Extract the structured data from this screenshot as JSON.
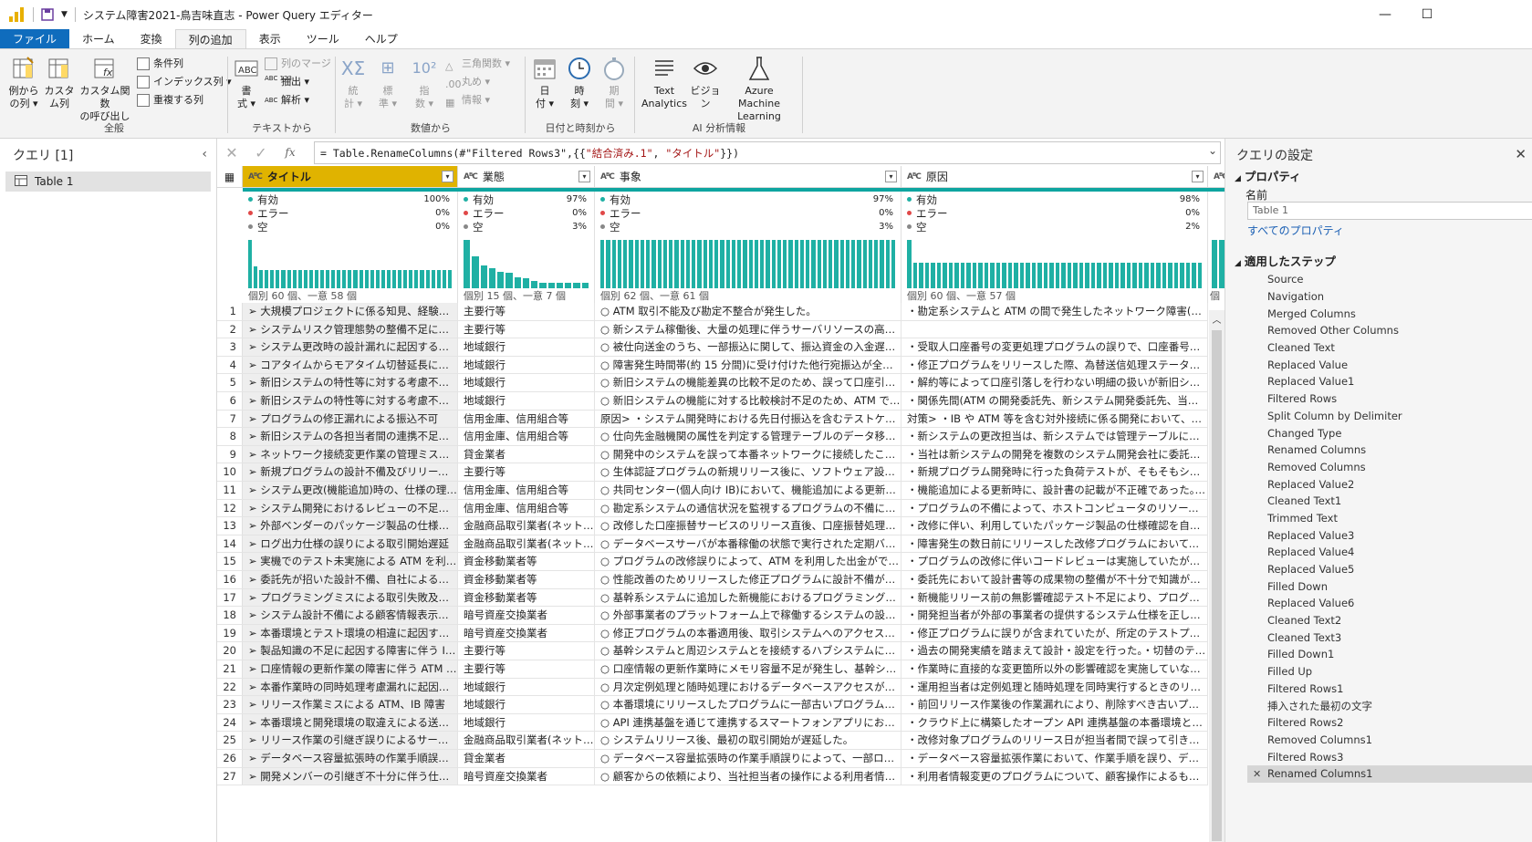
{
  "window": {
    "title": "システム障害2021-鳥吉味直志 - Power Query エディター",
    "controls": [
      "—",
      "☐",
      "✕"
    ]
  },
  "menu": [
    "ファイル",
    "ホーム",
    "変換",
    "列の追加",
    "表示",
    "ツール",
    "ヘルプ"
  ],
  "ribbon": {
    "general": {
      "label": "全般",
      "col_from_examples": [
        "例から",
        "の列 ▾"
      ],
      "custom_column": [
        "カスタ",
        "ム列"
      ],
      "invoke_custom_fn": [
        "カスタム関数",
        "の呼び出し"
      ],
      "conditional_column": "条件列",
      "index_column": "インデックス列 ▾",
      "duplicate_column": "重複する列"
    },
    "text": {
      "label": "テキストから",
      "format": [
        "書",
        "式 ▾"
      ],
      "merge_columns": "列のマージ",
      "extract": "抽出 ▾",
      "parse": "解析 ▾"
    },
    "number": {
      "label": "数値から",
      "statistics": [
        "統",
        "計 ▾"
      ],
      "standard": [
        "標",
        "準 ▾"
      ],
      "scientific": [
        "指",
        "数 ▾"
      ],
      "trig": "三角関数 ▾",
      "rounding": "丸め ▾",
      "information": "情報 ▾"
    },
    "datetime": {
      "label": "日付と時刻から",
      "date": [
        "日",
        "付 ▾"
      ],
      "time": [
        "時",
        "刻 ▾"
      ],
      "duration": [
        "期",
        "間 ▾"
      ]
    },
    "ai": {
      "label": "AI 分析情報",
      "text_analytics": [
        "Text",
        "Analytics"
      ],
      "vision": [
        "ビジョ",
        "ン"
      ],
      "azure_ml": [
        "Azure Machine",
        "Learning"
      ]
    }
  },
  "queries_pane": {
    "title": "クエリ [1]",
    "items": [
      "Table 1"
    ]
  },
  "formula_bar": {
    "prefix": "= Table.RenameColumns(#\"Filtered Rows3\",{{",
    "str1": "\"結合済み.1\"",
    "comma": ", ",
    "str2": "\"タイトル\"",
    "suffix": "}})"
  },
  "columns": [
    {
      "name": "タイトル",
      "valid": "100%",
      "error": "0%",
      "empty": "0%",
      "distinct": "個別 60 個、一意 58 個",
      "bars": [
        0.95,
        0.42,
        0.35,
        0.35,
        0.35,
        0.35,
        0.35,
        0.35,
        0.35,
        0.35,
        0.35,
        0.35,
        0.35,
        0.35,
        0.35,
        0.35,
        0.35,
        0.35,
        0.35,
        0.35,
        0.35,
        0.35,
        0.35,
        0.35,
        0.35,
        0.35,
        0.35,
        0.35,
        0.35,
        0.35,
        0.35,
        0.35,
        0.35,
        0.35,
        0.35,
        0.35,
        0.35
      ]
    },
    {
      "name": "業態",
      "valid": "97%",
      "error": "0%",
      "empty": "3%",
      "distinct": "個別 15 個、一意 7 個",
      "bars": [
        0.95,
        0.62,
        0.45,
        0.4,
        0.33,
        0.3,
        0.22,
        0.2,
        0.14,
        0.1,
        0.1,
        0.1,
        0.1,
        0.1,
        0.1
      ]
    },
    {
      "name": "事象",
      "valid": "97%",
      "error": "0%",
      "empty": "3%",
      "distinct": "個別 62 個、一意 61 個",
      "bars": [
        0.95,
        0.95,
        0.95,
        0.95,
        0.95,
        0.95,
        0.95,
        0.95,
        0.95,
        0.95,
        0.95,
        0.95,
        0.95,
        0.95,
        0.95,
        0.95,
        0.95,
        0.95,
        0.95,
        0.95,
        0.95,
        0.95,
        0.95,
        0.95,
        0.95,
        0.95,
        0.95,
        0.95,
        0.95,
        0.95,
        0.95,
        0.95,
        0.95,
        0.95,
        0.95,
        0.95,
        0.95,
        0.95,
        0.95,
        0.95,
        0.95,
        0.95,
        0.95,
        0.95,
        0.95,
        0.95,
        0.95,
        0.95,
        0.95,
        0.95,
        0.95,
        0.95
      ]
    },
    {
      "name": "原因",
      "valid": "98%",
      "error": "0%",
      "empty": "2%",
      "distinct": "個別 60 個、一意 57 個",
      "bars": [
        0.95,
        0.5,
        0.5,
        0.5,
        0.5,
        0.5,
        0.5,
        0.5,
        0.5,
        0.5,
        0.5,
        0.5,
        0.5,
        0.5,
        0.5,
        0.5,
        0.5,
        0.5,
        0.5,
        0.5,
        0.5,
        0.5,
        0.5,
        0.5,
        0.5,
        0.5,
        0.5,
        0.5,
        0.5,
        0.5,
        0.5,
        0.5,
        0.5,
        0.5,
        0.5,
        0.5,
        0.5,
        0.5,
        0.5,
        0.5,
        0.5,
        0.5,
        0.5,
        0.5,
        0.5,
        0.5,
        0.5,
        0.5,
        0.5,
        0.5
      ]
    }
  ],
  "stat_labels": {
    "valid": "有効",
    "error": "エラー",
    "empty": "空"
  },
  "partial_column_stat": "個",
  "rows": [
    [
      "1",
      "➢ 大規模プロジェクトに係る知見、経験等の不...",
      "主要行等",
      "○ ATM 取引不能及び勘定不整合が発生した。",
      "・勘定系システムと ATM の間で発生したネットワーク障害(障害に対..."
    ],
    [
      "2",
      "➢ システムリスク管理態勢の整備不足による...",
      "主要行等",
      "○ 新システム稼働後、大量の処理に伴うサーバリソースの高負荷、...",
      ""
    ],
    [
      "3",
      "➢ システム更改時の設計漏れに起因する被仕...",
      "地域銀行",
      "○ 被仕向送金のうち、一部振込に関して、振込資金の入金遅延・仕...",
      "・受取人口座番号の変更処理プログラムの誤りで、口座番号相違と..."
    ],
    [
      "4",
      "➢ コアタイムからモアタイム切替延長に伴う為...",
      "地域銀行",
      "○ 障害発生時間帯(約 15 分間)に受け付けた他行宛振込が全銀セ...",
      "・修正プログラムをリリースした際、為替送信処理ステータスがエラー..."
    ],
    [
      "5",
      "➢ 新旧システムの特性等に対する考慮不足に...",
      "地域銀行",
      "○ 新旧システムの機能差異の比較不足のため、誤って口座引落しさ...",
      "・解約等によって口座引落しを行わない明細の扱いが新旧システム..."
    ],
    [
      "6",
      "➢ 新旧システムの特性等に対する考慮不足に...",
      "地域銀行",
      "○ 新旧システムの機能に対する比較検討不足のため、ATM で言い...",
      "・関係先間(ATM の開発委託先、新システム開発委託先、当行)にお..."
    ],
    [
      "7",
      "➢ プログラムの修正漏れによる振込不可",
      "信用金庫、信用組合等",
      "原因> ・システム開発時における先日付振込を含むテストケースが...",
      "対策> ・IB や ATM 等を含む対外接続に係る開発において、オンライ..."
    ],
    [
      "8",
      "➢ 新旧システムの各担当者間の連携不足に...",
      "信用金庫、信用組合等",
      "○ 仕向先金融機関の属性を判定する管理テーブルのデータ移行が...",
      "・新システムの更改担当は、新システムでは管理テーブルによる判..."
    ],
    [
      "9",
      "➢ ネットワーク接続変更作業の管理ミスによる...",
      "貸金業者",
      "○ 開発中のシステムを誤って本番ネットワークに接続したことにより...",
      "・当社は新システムの開発を複数のシステム開発会社に委託して推..."
    ],
    [
      "10",
      "➢ 新規プログラムの設計不備及びリリース認...",
      "主要行等",
      "○ 生体認証プログラムの新規リリース後に、ソフトウェア設計に起因...",
      "・新規プログラム開発時に行った負荷テストが、そもそもシステム要..."
    ],
    [
      "11",
      "➢ システム更改(機能追加)時の、仕様の理解...",
      "信用金庫、信用組合等",
      "○ 共同センター(個人向け IB)において、機能追加による更新時に...",
      "・機能追加による更新時に、設計書の記載が不正確であった。・更改..."
    ],
    [
      "12",
      "➢ システム開発におけるレビューの不足による...",
      "信用金庫、信用組合等",
      "○ 勘定系システムの通信状況を監視するプログラムの不備によって...",
      "・プログラムの不備によって、ホストコンピュータのリソースが枯渇し、..."
    ],
    [
      "13",
      "➢ 外部ベンダーのパッケージ製品の仕様確認...",
      "金融商品取引業者(ネット証...",
      "○ 改修した口座振替サービスのリリース直後、口座振替処理が遅延...",
      "・改修に伴い、利用していたパッケージ製品の仕様確認を自社でしか..."
    ],
    [
      "14",
      "➢ ログ出力仕様の誤りによる取引開始遅延",
      "金融商品取引業者(ネット証...",
      "○ データベースサーバが本番稼働の状態で実行された定期バックアッ...",
      "・障害発生の数日前にリリースした改修プログラムにおいて、本来は..."
    ],
    [
      "15",
      "➢ 実機でのテスト未実施による ATM を利用し...",
      "資金移動業者等",
      "○ プログラムの改修誤りによって、ATM を利用した出金ができなくな...",
      "・プログラムの改修に伴いコードレビューは実施していたが、リリース..."
    ],
    [
      "16",
      "➢ 委託先が招いた設計不備、自社によるテス...",
      "資金移動業者等",
      "○ 性能改善のためリリースした修正プログラムに設計不備があり、送...",
      "・委託先において設計書等の成果物の整備が不十分で知識が属人..."
    ],
    [
      "17",
      "➢ プログラミングミスによる取引失敗及びその...",
      "資金移動業者等",
      "○ 基幹系システムに追加した新機能におけるプログラミングミスによ...",
      "・新機能リリース前の無影響確認テスト不足により、プログラミングミ..."
    ],
    [
      "18",
      "➢ システム設計不備による顧客情報表示の誤り",
      "暗号資産交換業者",
      "○ 外部事業者のプラットフォーム上で稼働するシステムの設計ミスに...",
      "・開発担当者が外部の事業者の提供するシステム仕様を正しく理解..."
    ],
    [
      "19",
      "➢ 本番環境とテスト環境の相違に起因する設...",
      "暗号資産交換業者",
      "○ 修正プログラムの本番適用後、取引システムへのアクセスが不可...",
      "・修正プログラムに誤りが含まれていたが、所定のテストプロセスで..."
    ],
    [
      "20",
      "➢ 製品知識の不足に起因する障害に伴う IB ...",
      "主要行等",
      "○ 基幹システムと周辺システムとを接続するハブシステムにおいて、...",
      "・過去の開発実績を踏まえて設計・設定を行った。・切替のテスト工..."
    ],
    [
      "21",
      "➢ 口座情報の更新作業の障害に伴う ATM の...",
      "主要行等",
      "○ 口座情報の更新作業時にメモリ容量不足が発生し、基幹システム...",
      "・作業時に直接的な変更箇所以外の影響確認を実施していなかった..."
    ],
    [
      "22",
      "➢ 本番作業時の同時処理考慮漏れに起因す...",
      "地域銀行",
      "○ 月次定例処理と随時処理におけるデータベースアクセスが競合し...",
      "・運用担当者は定例処理と随時処理を同時実行するときのリスクを..."
    ],
    [
      "23",
      "➢ リリース作業ミスによる ATM、IB 障害",
      "地域銀行",
      "○ 本番環境にリリースしたプログラムに一部古いプログラムが混入。...",
      "・前回リリース作業後の作業漏れにより、削除すべき古いプログラム..."
    ],
    [
      "24",
      "➢ 本番環境と開発環境の取違えによる送金障...",
      "地域銀行",
      "○ API 連携基盤を通じて連携するスマートフォンアプリにおいて他行...",
      "・クラウド上に構築したオープン API 連携基盤の本番環境と開発環境..."
    ],
    [
      "25",
      "➢ リリース作業の引継ぎ誤りによるサービス開...",
      "金融商品取引業者(ネット証...",
      "○ システムリリース後、最初の取引開始が遅延した。",
      "・改修対象プログラムのリリース日が担当者間で誤って引き継がれリ..."
    ],
    [
      "26",
      "➢ データベース容量拡張時の作業手順誤りに...",
      "貸金業者",
      "○ データベース容量拡張時の作業手順誤りによって、一部ローンサ...",
      "・データベース容量拡張作業において、作業手順を誤り、データ移行..."
    ],
    [
      "27",
      "➢ 開発メンバーの引継ぎ不十分に伴う仕様の...",
      "暗号資産交換業者",
      "○ 顧客からの依頼により、当社担当者の操作による利用者情報の変...",
      "・利用者情報変更のプログラムについて、顧客操作によるものと当社..."
    ]
  ],
  "settings_pane": {
    "title": "クエリの設定",
    "properties_header": "プロパティ",
    "name_label": "名前",
    "name_value": "Table 1",
    "all_properties": "すべてのプロパティ",
    "steps_header": "適用したステップ",
    "steps": [
      {
        "label": "Source",
        "gear": true
      },
      {
        "label": "Navigation",
        "gear": true
      },
      {
        "label": "Merged Columns",
        "gear": true
      },
      {
        "label": "Removed Other Columns",
        "gear": true
      },
      {
        "label": "Cleaned Text",
        "gear": false
      },
      {
        "label": "Replaced Value",
        "gear": true
      },
      {
        "label": "Replaced Value1",
        "gear": true
      },
      {
        "label": "Filtered Rows",
        "gear": true
      },
      {
        "label": "Split Column by Delimiter",
        "gear": true
      },
      {
        "label": "Changed Type",
        "gear": false
      },
      {
        "label": "Renamed Columns",
        "gear": true
      },
      {
        "label": "Removed Columns",
        "gear": false
      },
      {
        "label": "Replaced Value2",
        "gear": true
      },
      {
        "label": "Cleaned Text1",
        "gear": false
      },
      {
        "label": "Trimmed Text",
        "gear": false
      },
      {
        "label": "Replaced Value3",
        "gear": true
      },
      {
        "label": "Replaced Value4",
        "gear": true
      },
      {
        "label": "Replaced Value5",
        "gear": true
      },
      {
        "label": "Filled Down",
        "gear": false
      },
      {
        "label": "Replaced Value6",
        "gear": true
      },
      {
        "label": "Cleaned Text2",
        "gear": false
      },
      {
        "label": "Cleaned Text3",
        "gear": false
      },
      {
        "label": "Filled Down1",
        "gear": false
      },
      {
        "label": "Filled Up",
        "gear": false
      },
      {
        "label": "Filtered Rows1",
        "gear": true
      },
      {
        "label": "挿入された最初の文字",
        "gear": true
      },
      {
        "label": "Filtered Rows2",
        "gear": true
      },
      {
        "label": "Removed Columns1",
        "gear": true
      },
      {
        "label": "Filtered Rows3",
        "gear": true
      },
      {
        "label": "Renamed Columns1",
        "gear": false,
        "current": true
      }
    ]
  },
  "colors": {
    "accent": "#0f6cbd",
    "selected_header": "#e0b300",
    "profile_bar": "#1fb0a4",
    "valid": "#1fb0a4",
    "error": "#e04848",
    "empty": "#888888"
  }
}
